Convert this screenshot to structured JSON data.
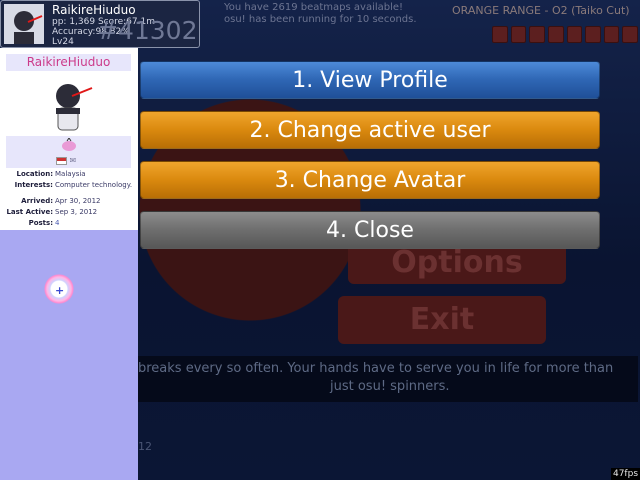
{
  "background": {
    "now_playing_line1": "You have 2619 beatmaps available!",
    "now_playing_line2": "osu! has been running for 10 seconds.",
    "song_title": "ORANGE RANGE - O2 (Taiko Cut)",
    "rank_overlay": "#41302",
    "menu_options": "Options",
    "menu_exit": "Exit",
    "tip_line1": "breaks every so often.  Your hands have to serve you in life for more than",
    "tip_line2": "just osu! spinners.",
    "corner_digits": "12"
  },
  "user_card": {
    "username": "RaikireHiuduo",
    "pp_score": "pp: 1,369 Score:67.1m",
    "accuracy": "Accuracy:98.82%",
    "level": "Lv24",
    "rank": "#41302"
  },
  "profile": {
    "name": "RaikireHiuduo",
    "fields": [
      {
        "key": "Location:",
        "value": "Malaysia"
      },
      {
        "key": "Interests:",
        "value": "Computer technology."
      },
      {
        "key": "Arrived:",
        "value": "Apr 30, 2012"
      },
      {
        "key": "Last Active:",
        "value": "Sep 3, 2012"
      },
      {
        "key": "Posts:",
        "value": "4"
      }
    ]
  },
  "menu": {
    "view_profile": "1. View Profile",
    "change_user": "2. Change active user",
    "change_avatar": "3. Change Avatar",
    "close": "4. Close"
  },
  "fps": "47fps",
  "colors": {
    "blue_button": "#2f67b5",
    "orange_button": "#db8a0f",
    "gray_button": "#6f6f6f",
    "profile_name": "#cc3a8a",
    "panel": "#a9a8f2"
  }
}
